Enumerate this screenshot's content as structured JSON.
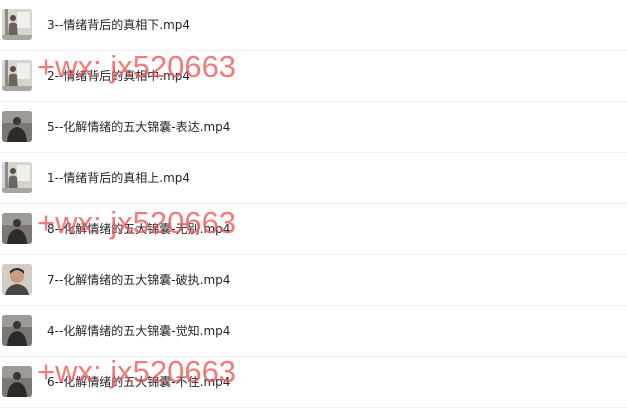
{
  "files": [
    {
      "name": "3--情绪背后的真相下.mp4",
      "thumb": "whiteboard"
    },
    {
      "name": "2--情绪背后的真相中.mp4",
      "thumb": "whiteboard"
    },
    {
      "name": "5--化解情绪的五大锦囊-表达.mp4",
      "thumb": "portrait"
    },
    {
      "name": "1--情绪背后的真相上.mp4",
      "thumb": "whiteboard"
    },
    {
      "name": "8--化解情绪的五大锦囊-无别.mp4",
      "thumb": "portrait"
    },
    {
      "name": "7--化解情绪的五大锦囊-破执.mp4",
      "thumb": "closeup"
    },
    {
      "name": "4--化解情绪的五大锦囊-觉知.mp4",
      "thumb": "portrait"
    },
    {
      "name": "6--化解情绪的五大锦囊-不住.mp4",
      "thumb": "portrait"
    }
  ],
  "watermark": {
    "text": "+wx: jx520663",
    "color": "#f05454"
  }
}
